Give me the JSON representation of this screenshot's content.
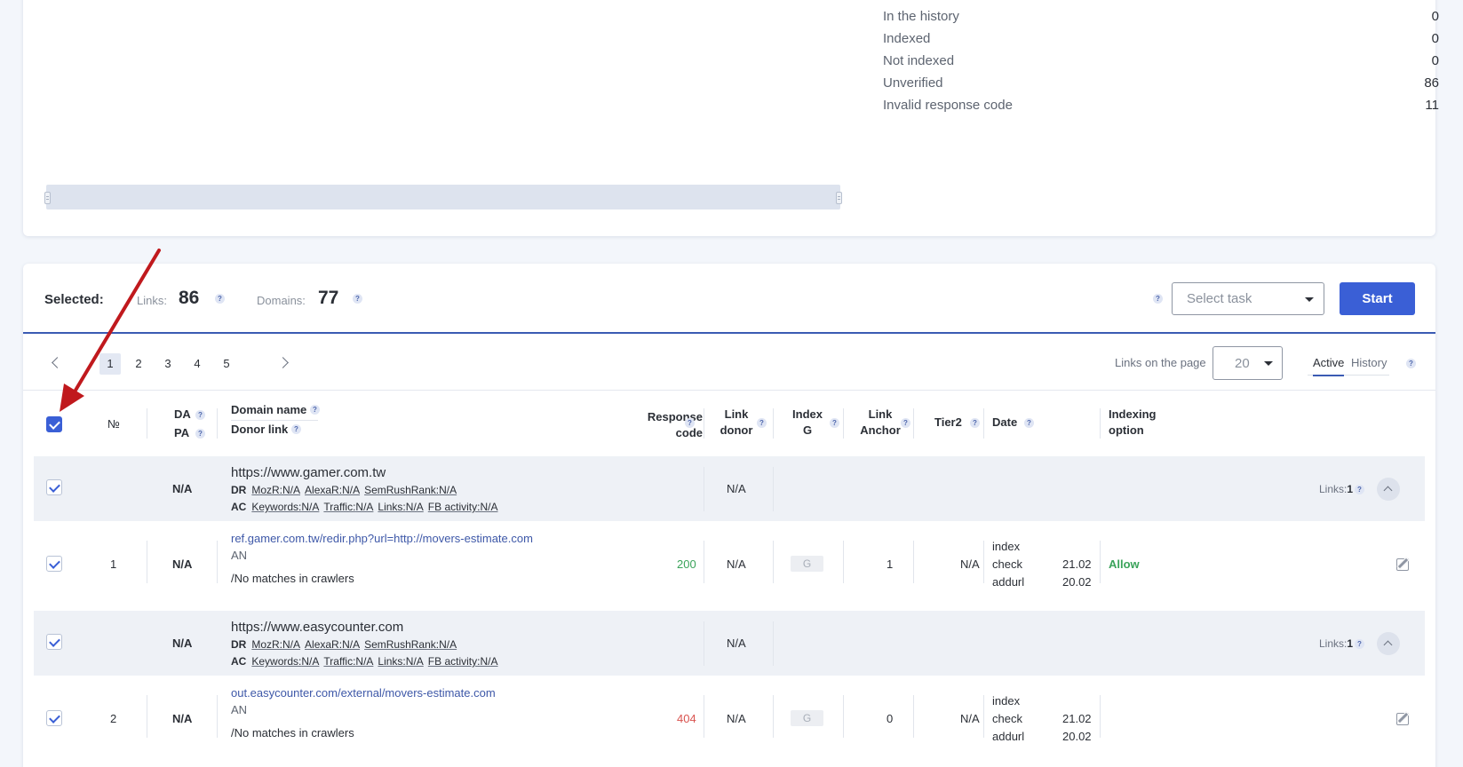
{
  "stats": [
    {
      "label": "In the history",
      "value": "0"
    },
    {
      "label": "Indexed",
      "value": "0"
    },
    {
      "label": "Not indexed",
      "value": "0"
    },
    {
      "label": "Unverified",
      "value": "86"
    },
    {
      "label": "Invalid response code",
      "value": "11"
    }
  ],
  "selected": {
    "label": "Selected:",
    "links_label": "Links:",
    "links_value": "86",
    "domains_label": "Domains:",
    "domains_value": "77",
    "help": "?",
    "select_task_placeholder": "Select task",
    "start_label": "Start"
  },
  "pagination": {
    "pages": [
      "1",
      "2",
      "3",
      "4",
      "5"
    ],
    "active_page": "1",
    "links_on_page_label": "Links on the page",
    "links_on_page_value": "20",
    "tab_active": "Active",
    "tab_history": "History"
  },
  "table": {
    "headers": {
      "num": "№",
      "da": "DA",
      "pa": "PA",
      "domain_name": "Domain name",
      "donor_link": "Donor link",
      "response_code_1": "Response",
      "response_code_2": "code",
      "link_donor_1": "Link",
      "link_donor_2": "donor",
      "index_g_1": "Index",
      "index_g_2": "G",
      "link_anchor_1": "Link",
      "link_anchor_2": "Anchor",
      "tier2": "Tier2",
      "date": "Date",
      "indexing_1": "Indexing",
      "indexing_2": "option"
    },
    "groups": [
      {
        "domain": "https://www.gamer.com.tw",
        "da": "N/A",
        "link_donor": "N/A",
        "links_label": "Links:",
        "links_count": "1",
        "metrics_dr": {
          "label": "DR",
          "items": [
            {
              "k": "MozR:",
              "v": "N/A"
            },
            {
              "k": "AlexaR:",
              "v": "N/A"
            },
            {
              "k": "SemRushRank:",
              "v": "N/A"
            }
          ]
        },
        "metrics_ac": {
          "label": "AC",
          "items": [
            {
              "k": "Keywords:",
              "v": "N/A"
            },
            {
              "k": "Traffic:",
              "v": "N/A"
            },
            {
              "k": "Links:",
              "v": "N/A"
            },
            {
              "k": "FB activity:",
              "v": "N/A"
            }
          ]
        },
        "row": {
          "num": "1",
          "da": "N/A",
          "donor_url": "ref.gamer.com.tw/redir.php?url=http://movers-estimate.com",
          "anchor": "AN",
          "crawlers": "/No matches in crawlers",
          "response_code": "200",
          "link_donor": "N/A",
          "index_g": "G",
          "link_anchor": "1",
          "tier2": "N/A",
          "date_index": "index",
          "date_check": "check",
          "date_check_value": "21.02",
          "date_addurl": "addurl",
          "date_addurl_value": "20.02",
          "indexing_option": "Allow"
        }
      },
      {
        "domain": "https://www.easycounter.com",
        "da": "N/A",
        "link_donor": "N/A",
        "links_label": "Links:",
        "links_count": "1",
        "metrics_dr": {
          "label": "DR",
          "items": [
            {
              "k": "MozR:",
              "v": "N/A"
            },
            {
              "k": "AlexaR:",
              "v": "N/A"
            },
            {
              "k": "SemRushRank:",
              "v": "N/A"
            }
          ]
        },
        "metrics_ac": {
          "label": "AC",
          "items": [
            {
              "k": "Keywords:",
              "v": "N/A"
            },
            {
              "k": "Traffic:",
              "v": "N/A"
            },
            {
              "k": "Links:",
              "v": "N/A"
            },
            {
              "k": "FB activity:",
              "v": "N/A"
            }
          ]
        },
        "row": {
          "num": "2",
          "da": "N/A",
          "donor_url": "out.easycounter.com/external/movers-estimate.com",
          "anchor": "AN",
          "crawlers": "/No matches in crawlers",
          "response_code": "404",
          "link_donor": "N/A",
          "index_g": "G",
          "link_anchor": "0",
          "tier2": "N/A",
          "date_index": "index",
          "date_check": "check",
          "date_check_value": "21.02",
          "date_addurl": "addurl",
          "date_addurl_value": "20.02",
          "indexing_option": ""
        }
      }
    ]
  },
  "colors": {
    "accent": "#3a5fd6",
    "ok": "#3aa35a",
    "error": "#d9534f",
    "arrow": "#c0191d"
  }
}
